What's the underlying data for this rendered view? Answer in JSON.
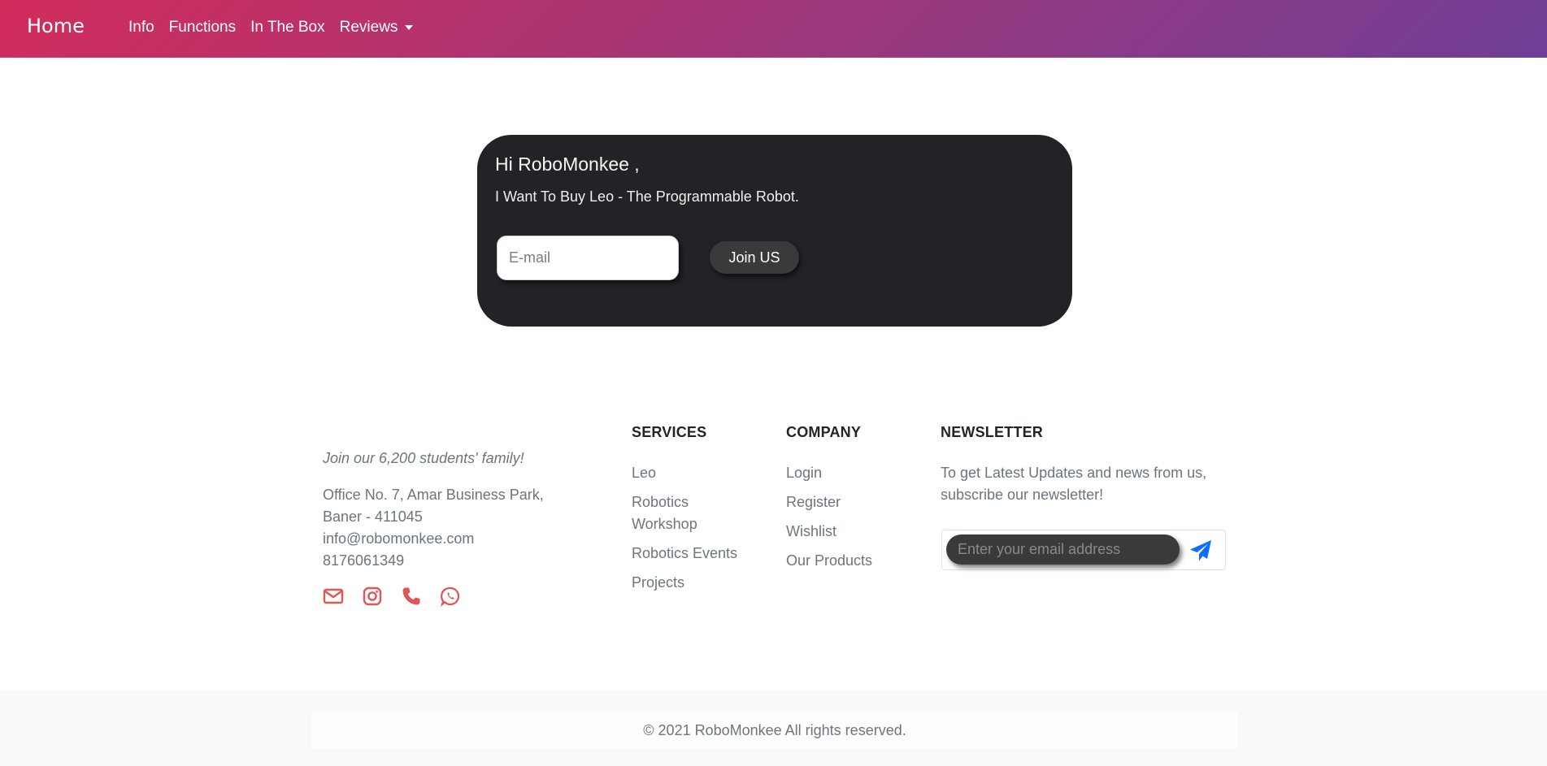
{
  "navbar": {
    "brand": "Home",
    "links": [
      "Info",
      "Functions",
      "In The Box"
    ],
    "dropdown_label": "Reviews"
  },
  "hero": {
    "greeting": "Hi RoboMonkee ,",
    "message": "I Want To Buy Leo - The Programmable Robot.",
    "email_placeholder": "E-mail",
    "join_label": "Join US"
  },
  "footer": {
    "tagline": "Join our 6,200 students' family!",
    "address_line1": "Office No. 7, Amar Business Park,",
    "address_line2": "Baner - 411045",
    "email": "info@robomonkee.com",
    "phone": "8176061349",
    "social_icons": [
      "envelope-icon",
      "instagram-icon",
      "phone-icon",
      "whatsapp-icon"
    ],
    "icon_color": "#e05555",
    "services": {
      "title": "SERVICES",
      "items": [
        "Leo",
        "Robotics Workshop",
        "Robotics Events",
        "Projects"
      ]
    },
    "company": {
      "title": "COMPANY",
      "items": [
        "Login",
        "Register",
        "Wishlist",
        "Our Products"
      ]
    },
    "newsletter": {
      "title": "NEWSLETTER",
      "text": "To get Latest Updates and news from us, subscribe our newsletter!",
      "placeholder": "Enter your email address",
      "send_icon": "paper-plane-icon",
      "send_color": "#0d6efd"
    },
    "copyright": "© 2021 RoboMonkee All rights reserved."
  }
}
